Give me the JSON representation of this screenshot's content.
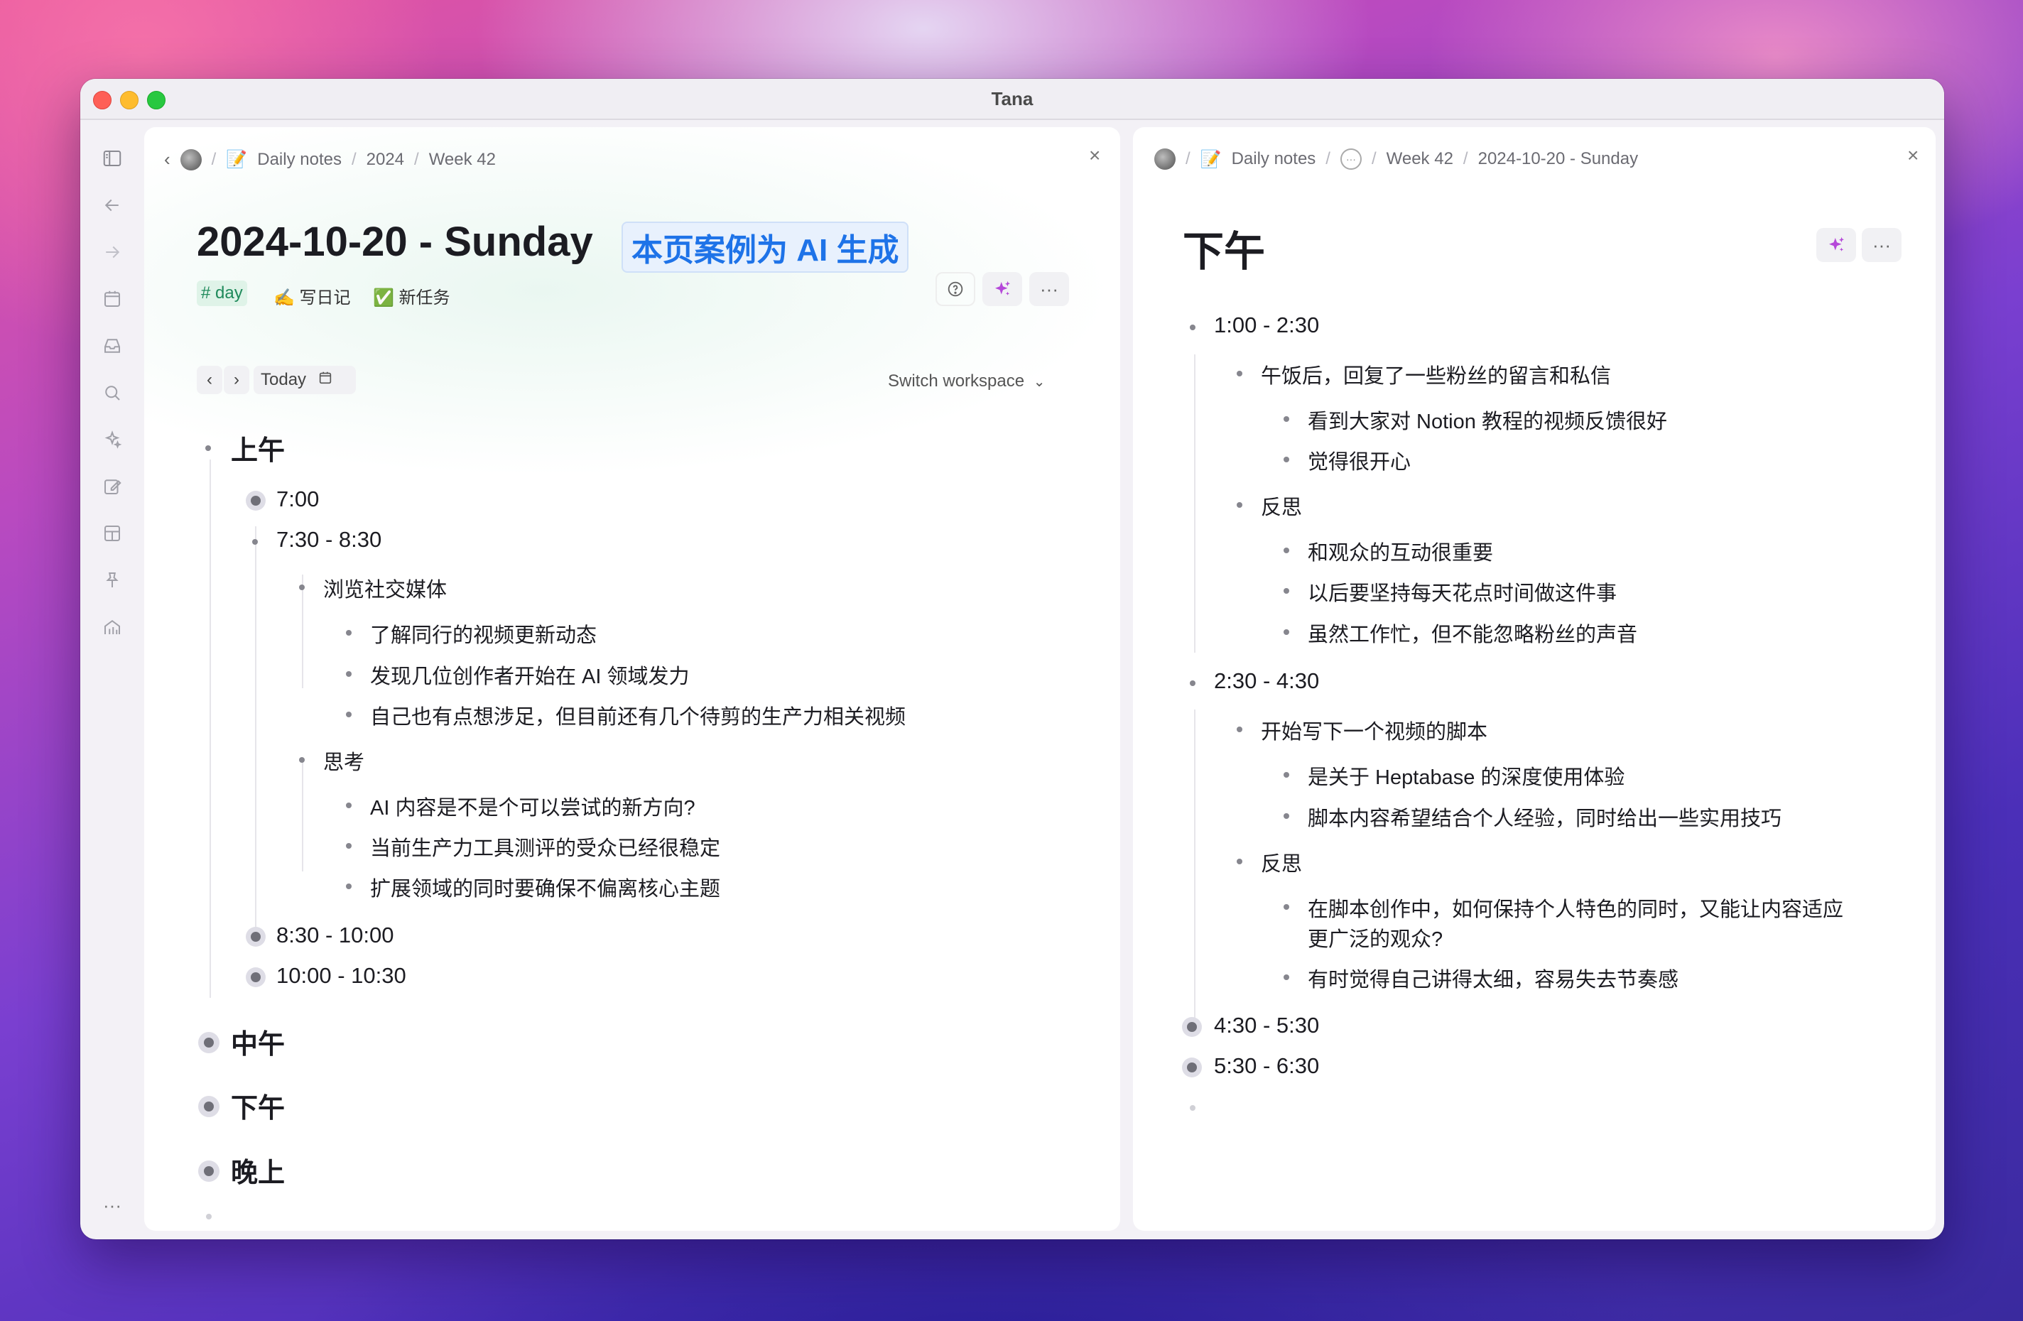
{
  "window": {
    "title": "Tana"
  },
  "sidebar": {
    "icons": [
      "sidebar-toggle-icon",
      "back-icon",
      "forward-icon",
      "calendar-icon",
      "inbox-icon",
      "search-icon",
      "ai-sparkle-icon",
      "edit-icon",
      "layout-icon",
      "pin-icon",
      "home-icon",
      "more-icon"
    ]
  },
  "left": {
    "breadcrumb": [
      "Daily notes",
      "2024",
      "Week 42"
    ],
    "title": "2024-10-20 - Sunday",
    "badge": "本页案例为 AI 生成",
    "tags": {
      "day": "# day",
      "diary": "✍️ 写日记",
      "task": "✅ 新任务"
    },
    "nav": {
      "today": "Today",
      "switch_workspace": "Switch workspace"
    },
    "outline": {
      "morning": "上午",
      "t1": "7:00",
      "t2": "7:30 - 8:30",
      "social": "浏览社交媒体",
      "s1": "了解同行的视频更新动态",
      "s2": "发现几位创作者开始在 AI 领域发力",
      "s3": "自己也有点想涉足，但目前还有几个待剪的生产力相关视频",
      "think": "思考",
      "k1": "AI 内容是不是个可以尝试的新方向?",
      "k2": "当前生产力工具测评的受众已经很稳定",
      "k3": "扩展领域的同时要确保不偏离核心主题",
      "t3": "8:30 - 10:00",
      "t4": "10:00 - 10:30",
      "noon": "中午",
      "afternoon": "下午",
      "evening": "晚上"
    }
  },
  "right": {
    "breadcrumb": [
      "Daily notes",
      "Week 42",
      "2024-10-20 - Sunday"
    ],
    "title": "下午",
    "outline": {
      "a1": "1:00 - 2:30",
      "a1_1": "午饭后，回复了一些粉丝的留言和私信",
      "a1_1_1": "看到大家对 Notion 教程的视频反馈很好",
      "a1_1_2": "觉得很开心",
      "a1_2": "反思",
      "a1_2_1": "和观众的互动很重要",
      "a1_2_2": "以后要坚持每天花点时间做这件事",
      "a1_2_3": "虽然工作忙，但不能忽略粉丝的声音",
      "a2": "2:30 - 4:30",
      "a2_1": "开始写下一个视频的脚本",
      "a2_1_1": "是关于 Heptabase 的深度使用体验",
      "a2_1_2": "脚本内容希望结合个人经验，同时给出一些实用技巧",
      "a2_2": "反思",
      "a2_2_1a": "在脚本创作中，如何保持个人特色的同时，又能让内容适应",
      "a2_2_1b": "更广泛的观众?",
      "a2_2_2": "有时觉得自己讲得太细，容易失去节奏感",
      "a3": "4:30 - 5:30",
      "a4": "5:30 - 6:30"
    }
  }
}
